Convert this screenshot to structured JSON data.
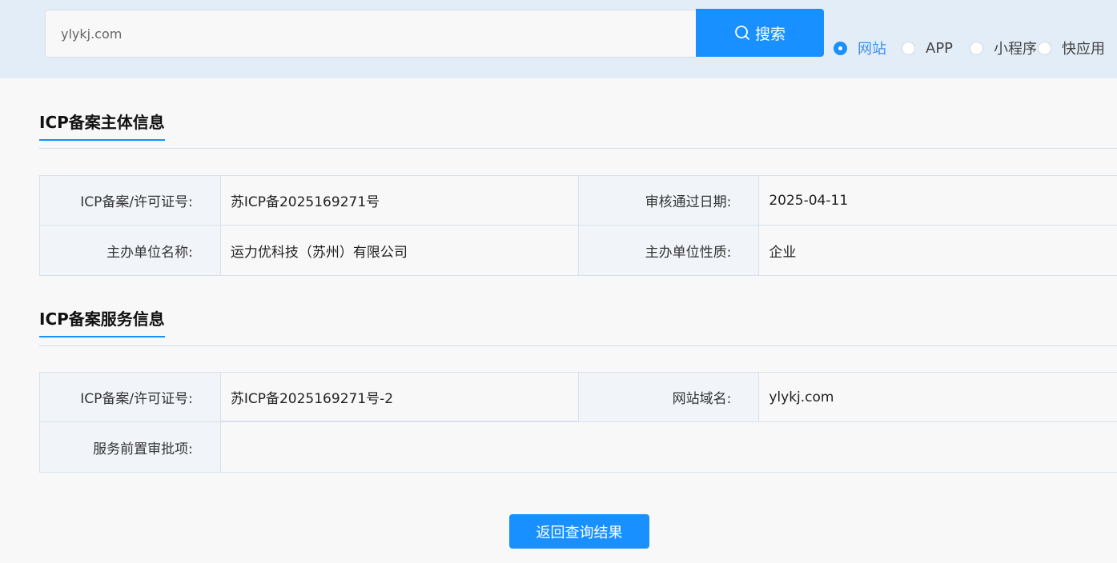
{
  "search": {
    "value": "ylykj.com",
    "button_label": "搜索"
  },
  "search_types": [
    {
      "label": "网站",
      "checked": true
    },
    {
      "label": "APP",
      "checked": false
    },
    {
      "label": "小程序",
      "checked": false
    },
    {
      "label": "快应用",
      "checked": false
    }
  ],
  "subject_section": {
    "title": "ICP备案主体信息",
    "rows": [
      {
        "label1": "ICP备案/许可证号:",
        "value1": "苏ICP备2025169271号",
        "label2": "审核通过日期:",
        "value2": "2025-04-11"
      },
      {
        "label1": "主办单位名称:",
        "value1": "运力优科技（苏州）有限公司",
        "label2": "主办单位性质:",
        "value2": "企业"
      }
    ]
  },
  "service_section": {
    "title": "ICP备案服务信息",
    "row1": {
      "label1": "ICP备案/许可证号:",
      "value1": "苏ICP备2025169271号-2",
      "label2": "网站域名:",
      "value2": "ylykj.com"
    },
    "row2": {
      "label": "服务前置审批项:",
      "value": ""
    }
  },
  "back_button": "返回查询结果",
  "colors": {
    "accent": "#1890ff",
    "topbar": "#e3edf8"
  }
}
